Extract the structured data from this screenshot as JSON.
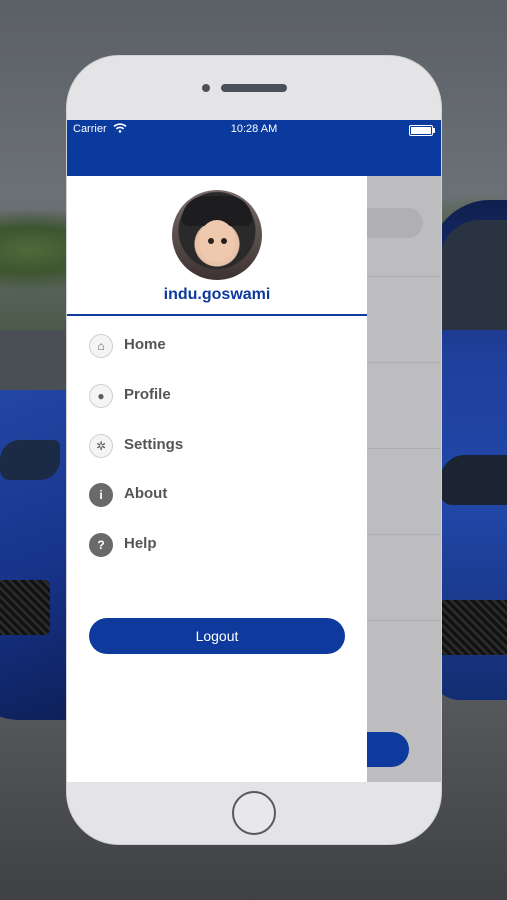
{
  "status_bar": {
    "carrier": "Carrier",
    "time": "10:28 AM"
  },
  "drawer": {
    "username": "indu.goswami",
    "menu": [
      {
        "label": "Home",
        "icon": "home-icon",
        "glyph": "⌂"
      },
      {
        "label": "Profile",
        "icon": "person-icon",
        "glyph": "●"
      },
      {
        "label": "Settings",
        "icon": "gear-icon",
        "glyph": "✲"
      },
      {
        "label": "About",
        "icon": "info-icon",
        "glyph": "i"
      },
      {
        "label": "Help",
        "icon": "help-icon",
        "glyph": "?"
      }
    ],
    "logout_label": "Logout"
  },
  "colors": {
    "primary": "#0d3a9c",
    "status_bar": "#0a3a9e",
    "menu_text": "#555555"
  }
}
